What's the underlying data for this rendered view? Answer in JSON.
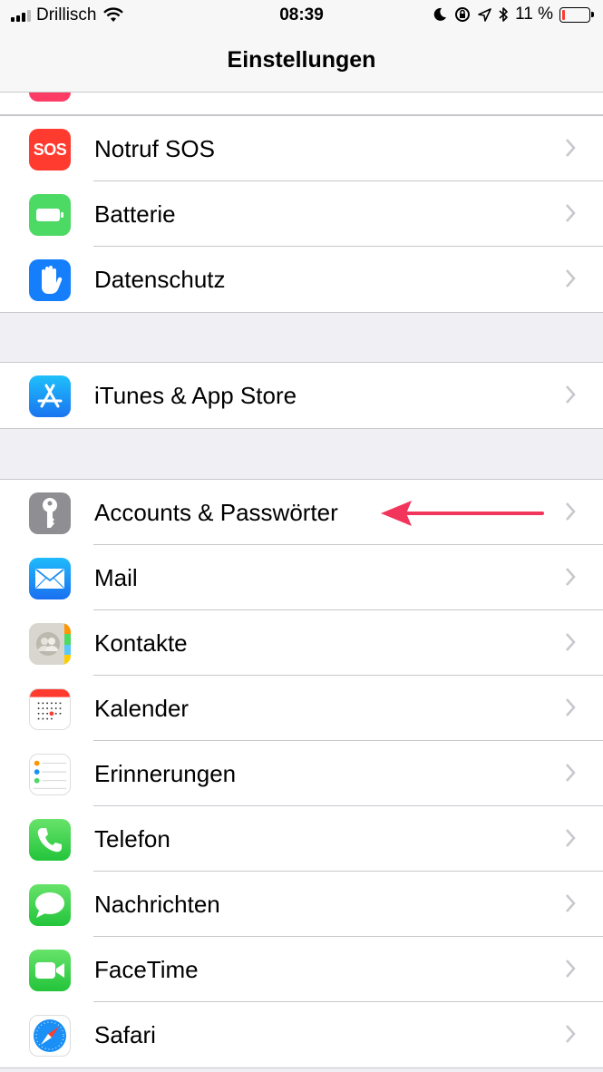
{
  "status_bar": {
    "carrier": "Drillisch",
    "time": "08:39",
    "battery_text": "11 %",
    "battery_level": 0.11
  },
  "nav": {
    "title": "Einstellungen"
  },
  "groups": [
    {
      "items": [
        {
          "label": "Notruf SOS",
          "icon": "sos-icon",
          "icon_text": "SOS",
          "color": "#ff3b30"
        },
        {
          "label": "Batterie",
          "icon": "battery-icon",
          "color": "#4cd964"
        },
        {
          "label": "Datenschutz",
          "icon": "hand-icon",
          "color": "#147efb"
        }
      ]
    },
    {
      "items": [
        {
          "label": "iTunes & App Store",
          "icon": "app-store-icon",
          "color": "#1a8ffb"
        }
      ]
    },
    {
      "items": [
        {
          "label": "Accounts & Passwörter",
          "icon": "key-icon",
          "color": "#8e8e93"
        },
        {
          "label": "Mail",
          "icon": "mail-icon",
          "color": "#1e88f5"
        },
        {
          "label": "Kontakte",
          "icon": "contacts-icon",
          "color": "#d3d0c8"
        },
        {
          "label": "Kalender",
          "icon": "calendar-icon",
          "color": "#ffffff"
        },
        {
          "label": "Erinnerungen",
          "icon": "reminders-icon",
          "color": "#ffffff"
        },
        {
          "label": "Telefon",
          "icon": "phone-icon",
          "color": "#4cd964"
        },
        {
          "label": "Nachrichten",
          "icon": "messages-icon",
          "color": "#4cd964"
        },
        {
          "label": "FaceTime",
          "icon": "facetime-icon",
          "color": "#4cd964"
        },
        {
          "label": "Safari",
          "icon": "safari-icon",
          "color": "#ffffff"
        }
      ]
    }
  ],
  "annotation": {
    "arrow_color": "#f2355b"
  }
}
